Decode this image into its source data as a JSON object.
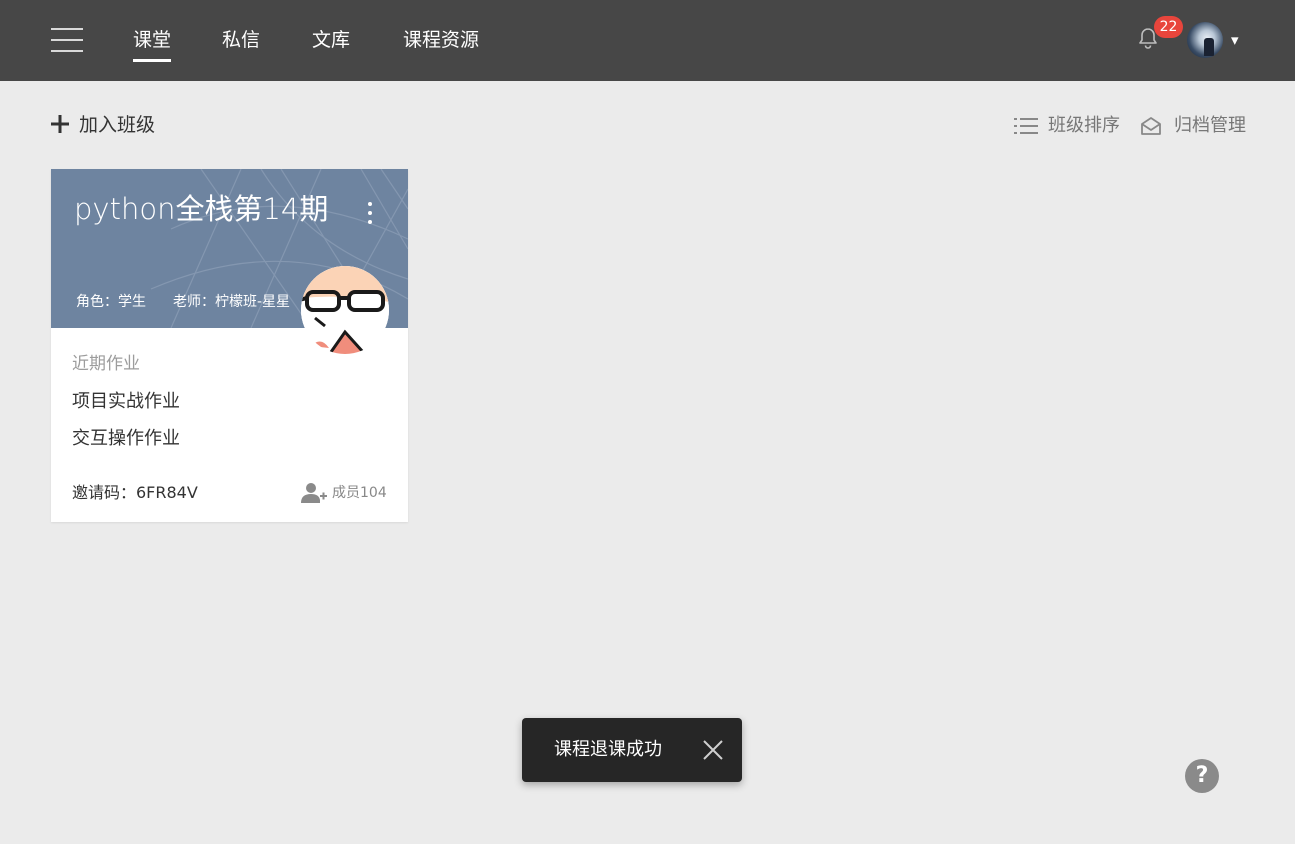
{
  "header": {
    "tabs": [
      {
        "label": "课堂",
        "active": true
      },
      {
        "label": "私信",
        "active": false
      },
      {
        "label": "文库",
        "active": false
      },
      {
        "label": "课程资源",
        "active": false
      }
    ],
    "notifications": {
      "icon": "bell-icon",
      "count": "22"
    },
    "user_menu": {
      "icon": "chevron-down-icon",
      "caret": "▾"
    }
  },
  "toolbar": {
    "join_label": "加入班级",
    "sort_label": "班级排序",
    "archive_label": "归档管理"
  },
  "course_card": {
    "title": "python全栈第14期",
    "role": "角色：学生",
    "teacher": "老师：柠檬班-星星",
    "recent_label": "近期作业",
    "homework": [
      "项目实战作业",
      "交互操作作业"
    ],
    "invite_code": "邀请码：6FR84V",
    "members": "成员104"
  },
  "toast": {
    "message": "课程退课成功"
  },
  "help": {
    "label": "?"
  },
  "colors": {
    "topbar": "#474747",
    "background": "#ebebeb",
    "card_header": "#6e84a0",
    "badge": "#e8453c",
    "toast": "#262626"
  }
}
